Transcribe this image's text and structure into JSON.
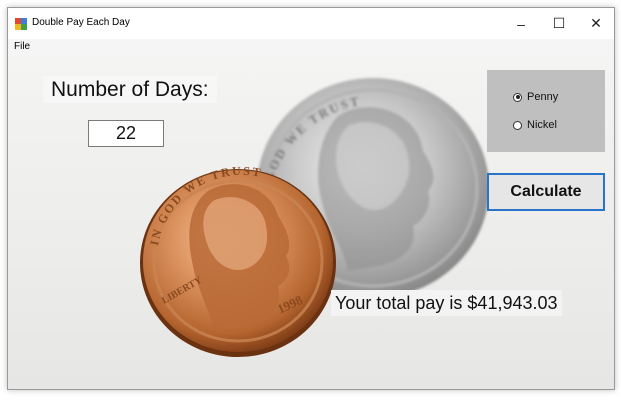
{
  "window": {
    "title": "Double Pay Each Day"
  },
  "menu": {
    "file": "File"
  },
  "controls": {
    "minimize": "–",
    "maximize": "☐",
    "close": "✕"
  },
  "form": {
    "days_label": "Number of Days:",
    "days_value": "22",
    "coin_options": [
      {
        "label": "Penny",
        "checked": true
      },
      {
        "label": "Nickel",
        "checked": false
      }
    ],
    "calculate_label": "Calculate",
    "result_text": "Your total pay is $41,943.03"
  },
  "images": {
    "nickel": {
      "text": "IN GOD WE TRUST",
      "year": ""
    },
    "penny": {
      "text": "IN GOD WE TRUST",
      "liberty": "LIBERTY",
      "year": "1998"
    }
  }
}
